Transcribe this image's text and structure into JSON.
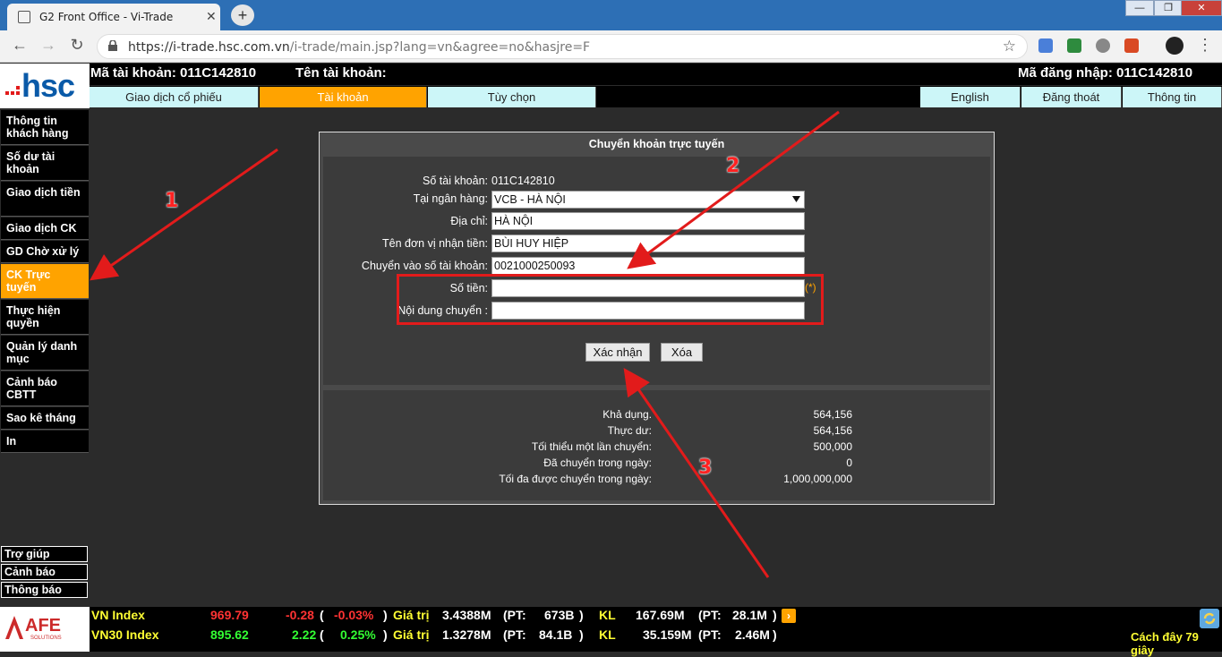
{
  "browser": {
    "tab_title": "G2 Front Office - Vi-Trade",
    "tab_close": "✕",
    "new_tab": "+",
    "url_host": "https://i-trade.hsc.com.vn",
    "url_path": "/i-trade/main.jsp?lang=vn&agree=no&hasjre=F",
    "back": "←",
    "forward": "→",
    "reload": "↻",
    "star": "☆",
    "menu": "⋮",
    "minimize": "—",
    "maximize": "❐",
    "close": "✕"
  },
  "header": {
    "logo_text": "hsc",
    "account_no_label": "Mã tài khoản: 011C142810",
    "account_name_label": "Tên tài khoản:",
    "login_id_label": "Mã đăng nhập: 011C142810"
  },
  "menu_tabs": [
    {
      "label": "Giao dịch cổ phiếu",
      "active": false
    },
    {
      "label": "Tài khoản",
      "active": true
    },
    {
      "label": "Tùy chọn",
      "active": false
    }
  ],
  "right_tabs": [
    {
      "label": "English"
    },
    {
      "label": "Đăng thoát"
    },
    {
      "label": "Thông tin"
    }
  ],
  "sidebar": {
    "items": [
      {
        "label": "Thông tin khách hàng"
      },
      {
        "label": "Số dư tài khoản"
      },
      {
        "label": "Giao dịch tiền"
      },
      {
        "label": "Giao dịch CK"
      },
      {
        "label": "GD Chờ xử lý"
      },
      {
        "label": "CK Trực tuyến"
      },
      {
        "label": "Thực hiện quyền"
      },
      {
        "label": "Quản lý danh mục"
      },
      {
        "label": "Cảnh báo CBTT"
      },
      {
        "label": "Sao kê tháng"
      },
      {
        "label": "In"
      }
    ],
    "help_items": [
      {
        "label": "Trợ giúp"
      },
      {
        "label": "Cảnh báo"
      },
      {
        "label": "Thông báo"
      }
    ]
  },
  "dialog": {
    "title": "Chuyển khoản trực tuyến",
    "account_label": "Số tài khoản:",
    "account_value": "011C142810",
    "bank_label": "Tại ngân hàng:",
    "bank_value": "VCB - HÀ NỘI",
    "address_label": "Địa chỉ:",
    "address_value": "HÀ NỘI",
    "recipient_label": "Tên đơn vị nhận tiền:",
    "recipient_value": "BÙI HUY HIỆP",
    "to_account_label": "Chuyển vào số tài khoản:",
    "to_account_value": "0021000250093",
    "amount_label": "Số tiền:",
    "amount_value": "",
    "required_mark": "(*)",
    "content_label": "Nội dung chuyển :",
    "content_value": "",
    "confirm_button": "Xác nhận",
    "clear_button": "Xóa",
    "info": [
      {
        "label": "Khả dụng.",
        "value": "564,156"
      },
      {
        "label": "Thực dư:",
        "value": "564,156"
      },
      {
        "label": "Tối thiểu một lần chuyển:",
        "value": "500,000"
      },
      {
        "label": "Đã chuyển trong ngày:",
        "value": "0"
      },
      {
        "label": "Tối đa được chuyển trong ngày:",
        "value": "1,000,000,000"
      }
    ]
  },
  "annotations": {
    "label_1": "1",
    "label_2": "2",
    "label_3": "3",
    "color": "#e21b1b"
  },
  "ticker": {
    "logo_text": "AFE",
    "logo_sub": "SOLUTIONS",
    "rows": [
      {
        "name": "VN Index",
        "value": "969.79",
        "change": "-0.28",
        "pct": "-0.03%",
        "value_label": "Giá trị",
        "trade_value": "3.4388M",
        "pt_label": "(PT:",
        "pt_value": "673B",
        "kl_label": "KL",
        "volume": "167.69M",
        "pt2_label": "(PT:",
        "pt2_value": "28.1M",
        "change_color": "#ff3333"
      },
      {
        "name": "VN30 Index",
        "value": "895.62",
        "change": "2.22",
        "pct": "0.25%",
        "value_label": "Giá trị",
        "trade_value": "1.3278M",
        "pt_label": "(PT:",
        "pt_value": "84.1B",
        "kl_label": "KL",
        "volume": "35.159M",
        "pt2_label": "(PT:",
        "pt2_value": "2.46M",
        "change_color": "#33ff33"
      }
    ],
    "updated_text": "Cách đây 79 giây"
  }
}
